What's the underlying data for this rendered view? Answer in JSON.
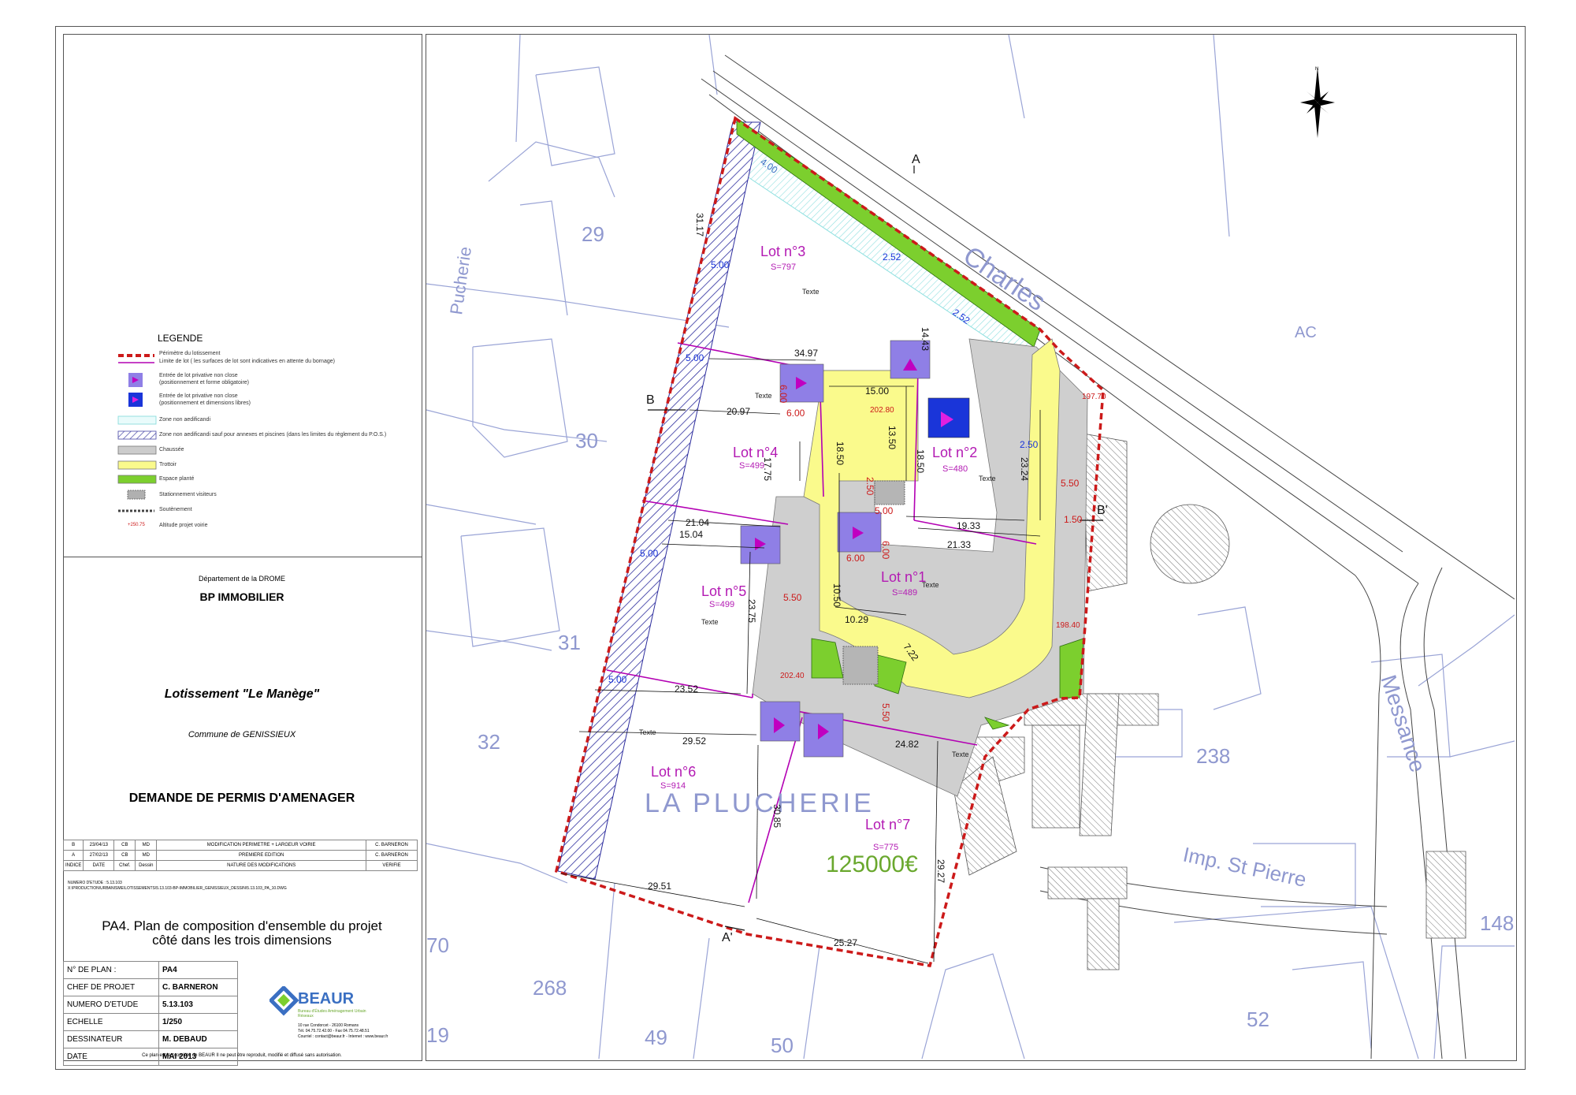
{
  "legend": {
    "title": "LEGENDE",
    "items": [
      {
        "symbol": "red-dashed-line",
        "label": "Périmètre du lotissement"
      },
      {
        "symbol": "magenta-line",
        "label": "Limite de lot ( les surfaces de lot sont indicatives en attente du bornage)"
      },
      {
        "symbol": "violet-square",
        "label": "Entrée de lot privative non close",
        "label2": "(positionnement et forme obligatoire)"
      },
      {
        "symbol": "blue-square",
        "label": "Entrée de lot privative non close",
        "label2": "(positionnement et dimensions libres)"
      },
      {
        "symbol": "cyan-hatch",
        "label": "Zone non aedificandi"
      },
      {
        "symbol": "blue-hatch",
        "label": "Zone non aedificandi sauf pour annexes et piscines (dans les limites du règlement du P.O.S.)"
      },
      {
        "symbol": "grey-fill",
        "label": "Chaussée"
      },
      {
        "symbol": "yellow-fill",
        "label": "Trottoir"
      },
      {
        "symbol": "green-fill",
        "label": "Espace planté"
      },
      {
        "symbol": "grey-dotted",
        "label": "Stationnement visiteurs"
      },
      {
        "symbol": "retaining-wall",
        "label": "Soutènement"
      },
      {
        "symbol": "red-altitude",
        "label": "Altitude projet voirie",
        "sample": "+250.75"
      }
    ]
  },
  "titleblock": {
    "department": "Département de la DROME",
    "client": "BP IMMOBILIER",
    "project": "Lotissement \"Le Manège\"",
    "commune": "Commune de GENISSIEUX",
    "request": "DEMANDE DE PERMIS D'AMENAGER",
    "revisions_header": [
      "INDICE",
      "DATE",
      "Chef.",
      "Dessin",
      "NATURE DES MODIFICATIONS",
      "VERIFIE"
    ],
    "revisions": [
      [
        "B",
        "23/04/13",
        "CB",
        "MD",
        "MODIFICATION PERIMETRE + LARGEUR VOIRIE",
        "C. BARNERON"
      ],
      [
        "A",
        "27/02/13",
        "CB",
        "MD",
        "PREMIERE EDITION",
        "C. BARNERON"
      ]
    ],
    "study_number": "NUMERO D'ETUDE : 5.13.103",
    "file_path": "X:\\PRODUCTION\\URBANISME\\LOTISSEMENTS\\5.13.103-BP-IMMOBILIER_GENISSIEUX_DESSIN\\5.13.103_PA_10.DWG",
    "plan_title_1": "PA4. Plan de composition d'ensemble du projet",
    "plan_title_2": "côté dans les trois dimensions",
    "info": [
      {
        "label": "N° DE PLAN :",
        "value": "PA4"
      },
      {
        "label": "CHEF DE PROJET",
        "value": "C. BARNERON"
      },
      {
        "label": "NUMERO D'ETUDE",
        "value": "5.13.103"
      },
      {
        "label": "ECHELLE",
        "value": "1/250"
      },
      {
        "label": "DESSINATEUR",
        "value": "M. DEBAUD"
      },
      {
        "label": "DATE",
        "value": "MAI 2013"
      }
    ],
    "company": "BEAUR",
    "company_tagline": "Bureau d'Études Aménagement Urbain Réseaux",
    "company_address": "10 rue Condorcet - 26100 Romans",
    "company_contact": "Tél. 04.75.72.42.00 - Fax 04.75.72.48.51",
    "company_web": "Courriel : contact@beaur.fr - Internet : www.beaur.fr",
    "copyright": "Ce plan est la propriété de BEAUR Il ne peut être reproduit, modifié et diffusé sans autorisation."
  },
  "map": {
    "lots": [
      {
        "name": "Lot n°3",
        "area": "S=797"
      },
      {
        "name": "Lot n°2",
        "area": "S=480"
      },
      {
        "name": "Lot n°4",
        "area": "S=499"
      },
      {
        "name": "Lot n°1",
        "area": "S=489"
      },
      {
        "name": "Lot n°5",
        "area": "S=499"
      },
      {
        "name": "Lot n°6",
        "area": "S=914"
      },
      {
        "name": "Lot n°7",
        "area": "S=775"
      }
    ],
    "price": "125000€",
    "texte_labels": [
      "Texte",
      "Texte",
      "Texte",
      "Texte",
      "Texte",
      "Texte",
      "Texte"
    ],
    "section_marks": [
      "A",
      "A'",
      "B",
      "B'"
    ],
    "parcels": [
      "29",
      "30",
      "31",
      "32",
      "238",
      "268",
      "49",
      "50",
      "52",
      "148",
      "70",
      "19",
      "AC"
    ],
    "street_labels": [
      "Charles",
      "Messance",
      "Imp. St Pierre",
      "LA PLUCHERIE",
      "Pucherie"
    ],
    "dimensions": [
      "34.97",
      "20.97",
      "15.00",
      "18.50",
      "13.50",
      "18.50",
      "21.04",
      "15.04",
      "17.75",
      "23.75",
      "10.50",
      "10.29",
      "6.00",
      "6.00",
      "6.00",
      "6.00",
      "5.00",
      "5.00",
      "5.00",
      "5.00",
      "5.00",
      "5.50",
      "5.50",
      "5.50",
      "1.50",
      "2.50",
      "2.50",
      "2.52",
      "2.52",
      "7.22",
      "23.52",
      "29.52",
      "24.82",
      "30.85",
      "29.51",
      "25.27",
      "29.27",
      "21.33",
      "19.33",
      "23.24",
      "14.43",
      "31.17",
      "4.00"
    ],
    "altitudes": [
      "202.80",
      "197.70",
      "202.40",
      "198.40"
    ]
  },
  "colors": {
    "perimeter": "#cc1a1a",
    "lot_limit": "#b300b3",
    "entry_violet": "#8f7fe6",
    "entry_blue": "#1a35d9",
    "trottoir": "#fafa8c",
    "espace_plante": "#7ccf2e",
    "chaussee": "#cccccc",
    "cadastre": "#9aa4d6",
    "lot_label": "#b31ab3",
    "price": "#6aa82e"
  }
}
